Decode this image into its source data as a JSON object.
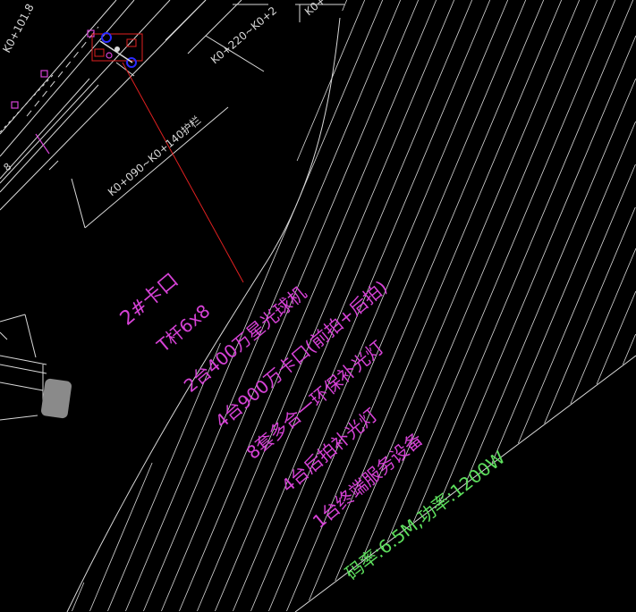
{
  "drawing": {
    "background": "#000000",
    "colors": {
      "magenta": "#d642d6",
      "green": "#5ddf5d",
      "red": "#e02020",
      "white": "#d9d9d9",
      "blue": "#2a2aff"
    },
    "road_labels": {
      "top_left": "K0+101.8",
      "top_mid": "K0+220~K0+2",
      "top_right": "K0+",
      "segment": "K0+090~K0+140护栏",
      "tick_mark": "8"
    },
    "checkpoint": {
      "title": "2#卡口",
      "lines": [
        "T杆6x8",
        "2台400万星光球机",
        "4台900万卡口(前拍+后拍)",
        "8套多合一环保补光灯",
        "4台后拍补光灯",
        "1台终端服务设备"
      ]
    },
    "power": {
      "text": "码率:6.5M,功率:1200W"
    },
    "icons": [
      "camera-pole-icon",
      "vehicle-icon"
    ]
  }
}
